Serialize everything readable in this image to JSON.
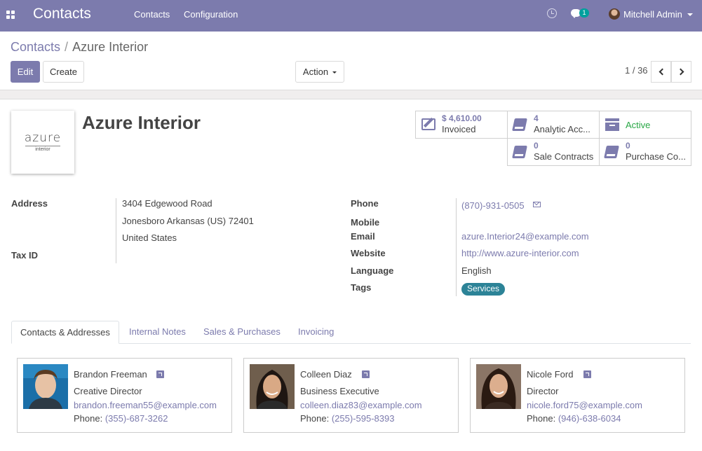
{
  "navbar": {
    "brand": "Contacts",
    "menu": [
      "Contacts",
      "Configuration"
    ],
    "chat_badge": "1",
    "user": "Mitchell Admin"
  },
  "breadcrumb": {
    "parent": "Contacts",
    "current": "Azure Interior"
  },
  "buttons": {
    "edit": "Edit",
    "create": "Create",
    "action": "Action"
  },
  "pager": {
    "value": "1 / 36"
  },
  "partner": {
    "name": "Azure Interior",
    "logo_text": "azure",
    "logo_sub": "interior"
  },
  "smart_buttons": {
    "invoiced": {
      "value": "$ 4,610.00",
      "label": "Invoiced"
    },
    "analytic": {
      "value": "4",
      "label": "Analytic Acc..."
    },
    "active": {
      "label": "Active"
    },
    "sale_contracts": {
      "value": "0",
      "label": "Sale Contracts"
    },
    "purchase": {
      "value": "0",
      "label": "Purchase Co..."
    }
  },
  "fields": {
    "address_label": "Address",
    "address_line1": "3404 Edgewood Road",
    "address_line2": "Jonesboro  Arkansas (US)  72401",
    "address_line3": "United States",
    "tax_id_label": "Tax ID",
    "phone_label": "Phone",
    "phone": "(870)-931-0505",
    "mobile_label": "Mobile",
    "email_label": "Email",
    "email": "azure.Interior24@example.com",
    "website_label": "Website",
    "website": "http://www.azure-interior.com",
    "language_label": "Language",
    "language": "English",
    "tags_label": "Tags",
    "tag": "Services"
  },
  "tabs": [
    "Contacts & Addresses",
    "Internal Notes",
    "Sales & Purchases",
    "Invoicing"
  ],
  "phone_prefix": "Phone: ",
  "contacts": [
    {
      "name": "Brandon Freeman",
      "function": "Creative Director",
      "email": "brandon.freeman55@example.com",
      "phone": "(355)-687-3262"
    },
    {
      "name": "Colleen Diaz",
      "function": "Business Executive",
      "email": "colleen.diaz83@example.com",
      "phone": "(255)-595-8393"
    },
    {
      "name": "Nicole Ford",
      "function": "Director",
      "email": "nicole.ford75@example.com",
      "phone": "(946)-638-6034"
    }
  ],
  "colors": {
    "brand": "#7c7bad",
    "active": "#28a745",
    "tag": "#2c8397",
    "badge": "#00a09d"
  }
}
